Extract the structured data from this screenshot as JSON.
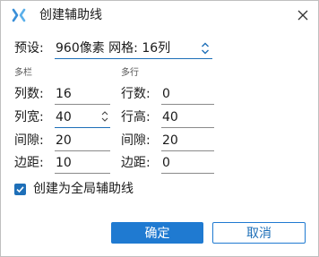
{
  "window": {
    "title": "创建辅助线",
    "close_icon": "close-icon",
    "app_icon": "x-logo-icon"
  },
  "preset": {
    "label": "预设:",
    "value": "960像素 网格: 16列"
  },
  "columns": {
    "group_title": "多栏",
    "count_label": "列数:",
    "count_value": "16",
    "width_label": "列宽:",
    "width_value": "40",
    "gap_label": "间隙:",
    "gap_value": "20",
    "margin_label": "边距:",
    "margin_value": "10"
  },
  "rows": {
    "group_title": "多行",
    "count_label": "行数:",
    "count_value": "0",
    "height_label": "行高:",
    "height_value": "40",
    "gap_label": "间隙:",
    "gap_value": "20",
    "margin_label": "边距:",
    "margin_value": "0"
  },
  "global_guides": {
    "label": "创建为全局辅助线",
    "checked": true
  },
  "buttons": {
    "ok": "确定",
    "cancel": "取消"
  },
  "colors": {
    "accent": "#1f7ad1",
    "brand_logo": "#3a8fd8"
  }
}
